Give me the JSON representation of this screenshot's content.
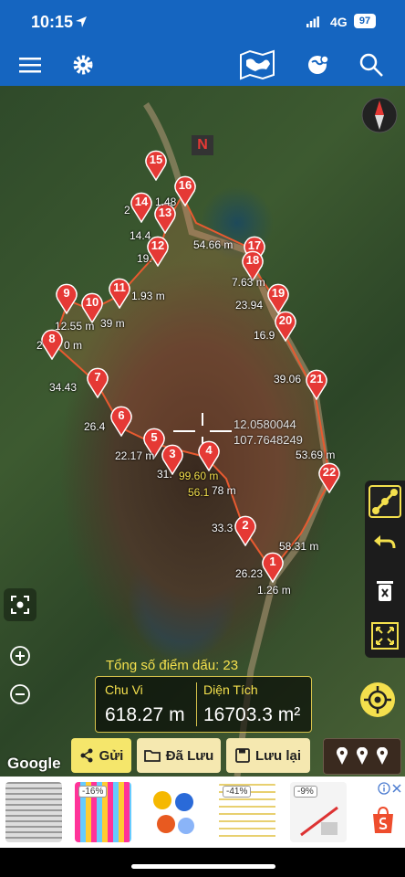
{
  "status_bar": {
    "time": "10:15",
    "network": "4G",
    "battery": "97"
  },
  "top_bar": {
    "icons": [
      "menu-icon",
      "gear-icon",
      "map-icon",
      "globe-icon",
      "search-icon"
    ]
  },
  "map": {
    "north_label": "N",
    "center_coords": {
      "lat": "12.0580044",
      "lng": "107.7648249"
    },
    "cursor_labels": {
      "a": "99.60 m",
      "b": "56.1"
    },
    "markers": [
      {
        "n": "1",
        "label": "1"
      },
      {
        "n": "2",
        "label": "2"
      },
      {
        "n": "3",
        "label": "3"
      },
      {
        "n": "4",
        "label": "4"
      },
      {
        "n": "5",
        "label": "5"
      },
      {
        "n": "6",
        "label": "6"
      },
      {
        "n": "7",
        "label": "7"
      },
      {
        "n": "8",
        "label": "8"
      },
      {
        "n": "9",
        "label": "9"
      },
      {
        "n": "10",
        "label": "10"
      },
      {
        "n": "11",
        "label": "11"
      },
      {
        "n": "12",
        "label": "12"
      },
      {
        "n": "13",
        "label": "13"
      },
      {
        "n": "14",
        "label": "14"
      },
      {
        "n": "15",
        "label": "15"
      },
      {
        "n": "16",
        "label": "16"
      },
      {
        "n": "17",
        "label": "17"
      },
      {
        "n": "18",
        "label": "18"
      },
      {
        "n": "19",
        "label": "19"
      },
      {
        "n": "20",
        "label": "20"
      },
      {
        "n": "21",
        "label": "21"
      },
      {
        "n": "22",
        "label": "22"
      }
    ],
    "distances": {
      "d1": "1.26 m",
      "d2": "26.23",
      "d3": "33.3",
      "d4": "58.31 m",
      "d5": "53.69 m",
      "d6": "39.06",
      "d7": "16.9",
      "d8": "23.94",
      "d9": "7.63 m",
      "d10": "54.66 m",
      "d11": "19.",
      "d12": "14.4",
      "d13": "1.48",
      "d14": "2",
      "d15": "1.93 m",
      "d16": "39 m",
      "d17": "12.55 m",
      "d18": "2",
      "d19": "0 m",
      "d20": "34.43",
      "d21": "26.4",
      "d22": "22.17 m",
      "d23": "31.",
      "d24": "5",
      "d25": "78 m",
      "d26": "4 m"
    }
  },
  "summary": {
    "title": "Tổng số điểm dấu: 23",
    "perimeter_label": "Chu Vi",
    "perimeter_value": "618.27 m",
    "area_label": "Diện Tích",
    "area_value": "16703.3 m²"
  },
  "bottom_buttons": {
    "send": "Gửi",
    "saved": "Đã Lưu",
    "save": "Lưu lại"
  },
  "google_logo": "Google",
  "ads": {
    "badges": [
      "-16%",
      "-41%",
      "-9%"
    ]
  },
  "colors": {
    "header_blue": "#1565c0",
    "marker_red": "#e53935",
    "summary_gold": "#f4e04d",
    "button_yellow": "#f5e66b"
  }
}
